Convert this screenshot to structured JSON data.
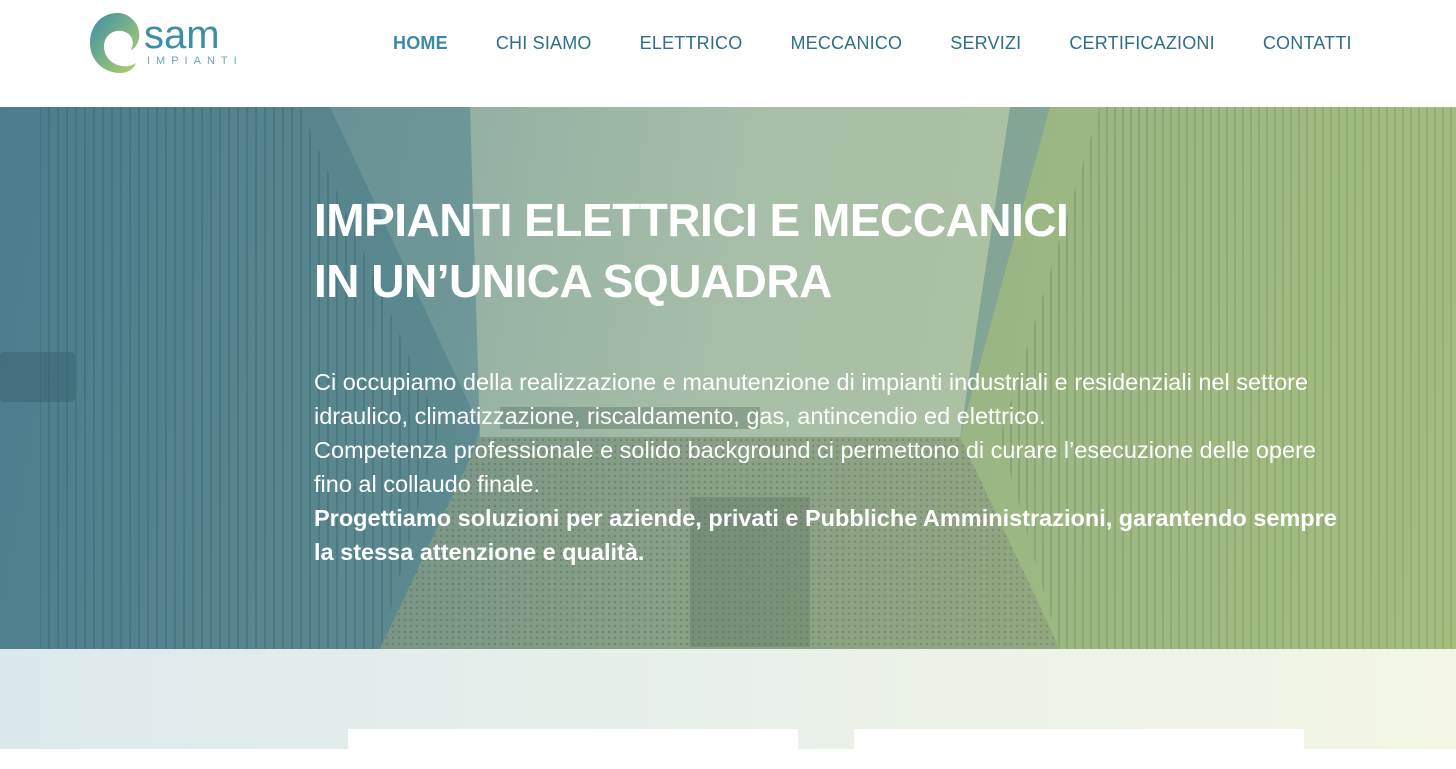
{
  "brand": {
    "name": "sam",
    "sub": "IMPIANTI"
  },
  "nav": [
    {
      "label": "HOME",
      "active": true
    },
    {
      "label": "CHI SIAMO"
    },
    {
      "label": "ELETTRICO"
    },
    {
      "label": "MECCANICO"
    },
    {
      "label": "SERVIZI"
    },
    {
      "label": "CERTIFICAZIONI"
    },
    {
      "label": "CONTATTI"
    }
  ],
  "hero": {
    "title_line1": "IMPIANTI ELETTRICI E MECCANICI",
    "title_line2": "IN UN’UNICA SQUADRA",
    "para1": "Ci occupiamo della realizzazione e manutenzione di impianti industriali e residenziali nel settore idraulico, climatizzazione, riscaldamento, gas, antincendio ed elettrico.",
    "para2": "Competenza professionale e solido background ci permettono di curare l’esecuzione delle opere fino al collaudo finale.",
    "para3": "Progettiamo soluzioni per aziende, privati e Pubbliche Amministrazioni, garantendo sempre la stessa attenzione e qualità."
  },
  "colors": {
    "brand_teal": "#3b8ea6",
    "nav_text": "#2e6f86",
    "hero_left": "#46788a",
    "hero_right": "#afc36e"
  }
}
